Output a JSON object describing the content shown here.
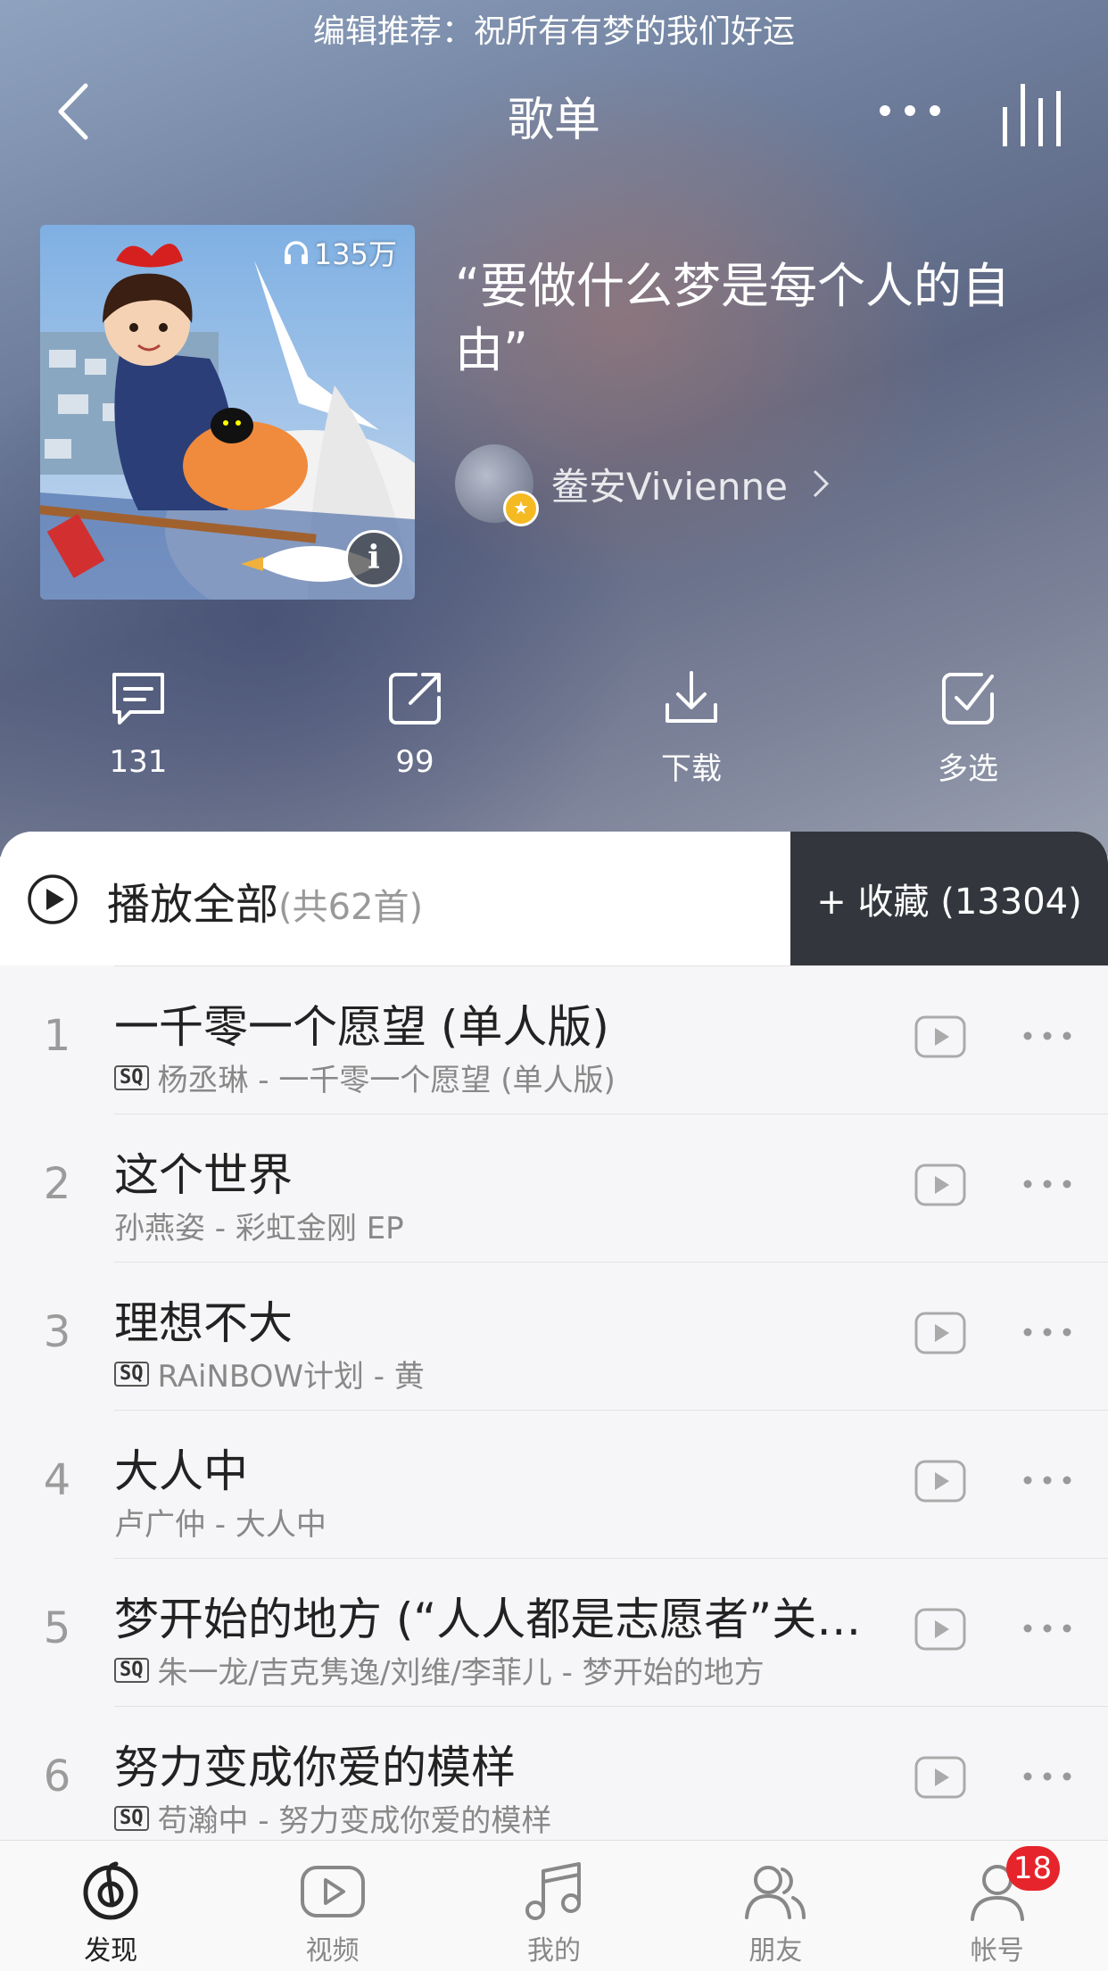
{
  "banner": "编辑推荐：祝所有有梦的我们好运",
  "header": {
    "title": "歌单"
  },
  "playlist": {
    "play_count": "135万",
    "title": "“要做什么梦是每个人的自由”",
    "creator": "鲞安Vivienne"
  },
  "actions": [
    {
      "label": "131",
      "icon": "comment-icon"
    },
    {
      "label": "99",
      "icon": "share-icon"
    },
    {
      "label": "下载",
      "icon": "download-icon"
    },
    {
      "label": "多选",
      "icon": "multi-select-icon"
    }
  ],
  "play_all": {
    "label": "播放全部",
    "count": "(共62首)"
  },
  "collect": {
    "label": "+ 收藏 (13304)"
  },
  "sq_label": "SQ",
  "songs": [
    {
      "index": "1",
      "title": "一千零一个愿望 (单人版)",
      "subtitle": "杨丞琳 - 一千零一个愿望 (单人版)",
      "sq": true
    },
    {
      "index": "2",
      "title": "这个世界",
      "subtitle": "孙燕姿 - 彩虹金刚 EP",
      "sq": false
    },
    {
      "index": "3",
      "title": "理想不大",
      "subtitle": "RAiNBOW计划 - 黄",
      "sq": true
    },
    {
      "index": "4",
      "title": "大人中",
      "subtitle": "卢广仲 - 大人中",
      "sq": false
    },
    {
      "index": "5",
      "title": "梦开始的地方 (“人人都是志愿者”关…",
      "subtitle": "朱一龙/吉克隽逸/刘维/李菲儿 - 梦开始的地方",
      "sq": true
    },
    {
      "index": "6",
      "title": "努力变成你爱的模样",
      "subtitle": "苟瀚中 - 努力变成你爱的模样",
      "sq": true
    }
  ],
  "tabs": [
    {
      "label": "发现",
      "icon": "discover-icon",
      "active": true
    },
    {
      "label": "视频",
      "icon": "video-icon"
    },
    {
      "label": "我的",
      "icon": "music-note-icon"
    },
    {
      "label": "朋友",
      "icon": "friends-icon"
    },
    {
      "label": "帐号",
      "icon": "account-icon",
      "badge": "18"
    }
  ],
  "colors": {
    "accent_red": "#e6242b",
    "collect_bg": "#33373d"
  }
}
